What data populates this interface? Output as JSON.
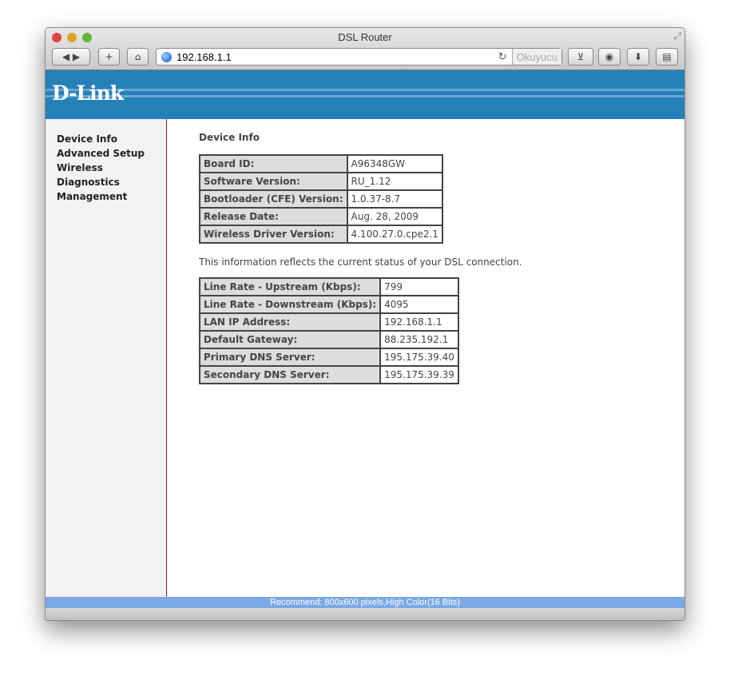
{
  "browser": {
    "title": "DSL Router",
    "url": "192.168.1.1",
    "reader_label": "Okuyucu"
  },
  "brand": {
    "logo": "D-Link"
  },
  "sidebar": {
    "items": [
      {
        "label": "Device Info"
      },
      {
        "label": "Advanced Setup"
      },
      {
        "label": "Wireless"
      },
      {
        "label": "Diagnostics"
      },
      {
        "label": "Management"
      }
    ]
  },
  "main": {
    "heading": "Device Info",
    "device_table": [
      {
        "k": "Board ID:",
        "v": "A96348GW"
      },
      {
        "k": "Software Version:",
        "v": "RU_1.12"
      },
      {
        "k": "Bootloader (CFE) Version:",
        "v": "1.0.37-8.7"
      },
      {
        "k": "Release Date:",
        "v": "Aug. 28, 2009"
      },
      {
        "k": "Wireless Driver Version:",
        "v": "4.100.27.0.cpe2.1"
      }
    ],
    "info_text": "This information reflects the current status of your DSL connection.",
    "status_table": [
      {
        "k": "Line Rate - Upstream (Kbps):",
        "v": "799"
      },
      {
        "k": "Line Rate - Downstream (Kbps):",
        "v": "4095"
      },
      {
        "k": "LAN IP Address:",
        "v": "192.168.1.1"
      },
      {
        "k": "Default Gateway:",
        "v": "88.235.192.1"
      },
      {
        "k": "Primary DNS Server:",
        "v": "195.175.39.40"
      },
      {
        "k": "Secondary DNS Server:",
        "v": "195.175.39.39"
      }
    ]
  },
  "footer": {
    "text": "Recommend: 800x600 pixels,High Color(16 Bits)"
  }
}
